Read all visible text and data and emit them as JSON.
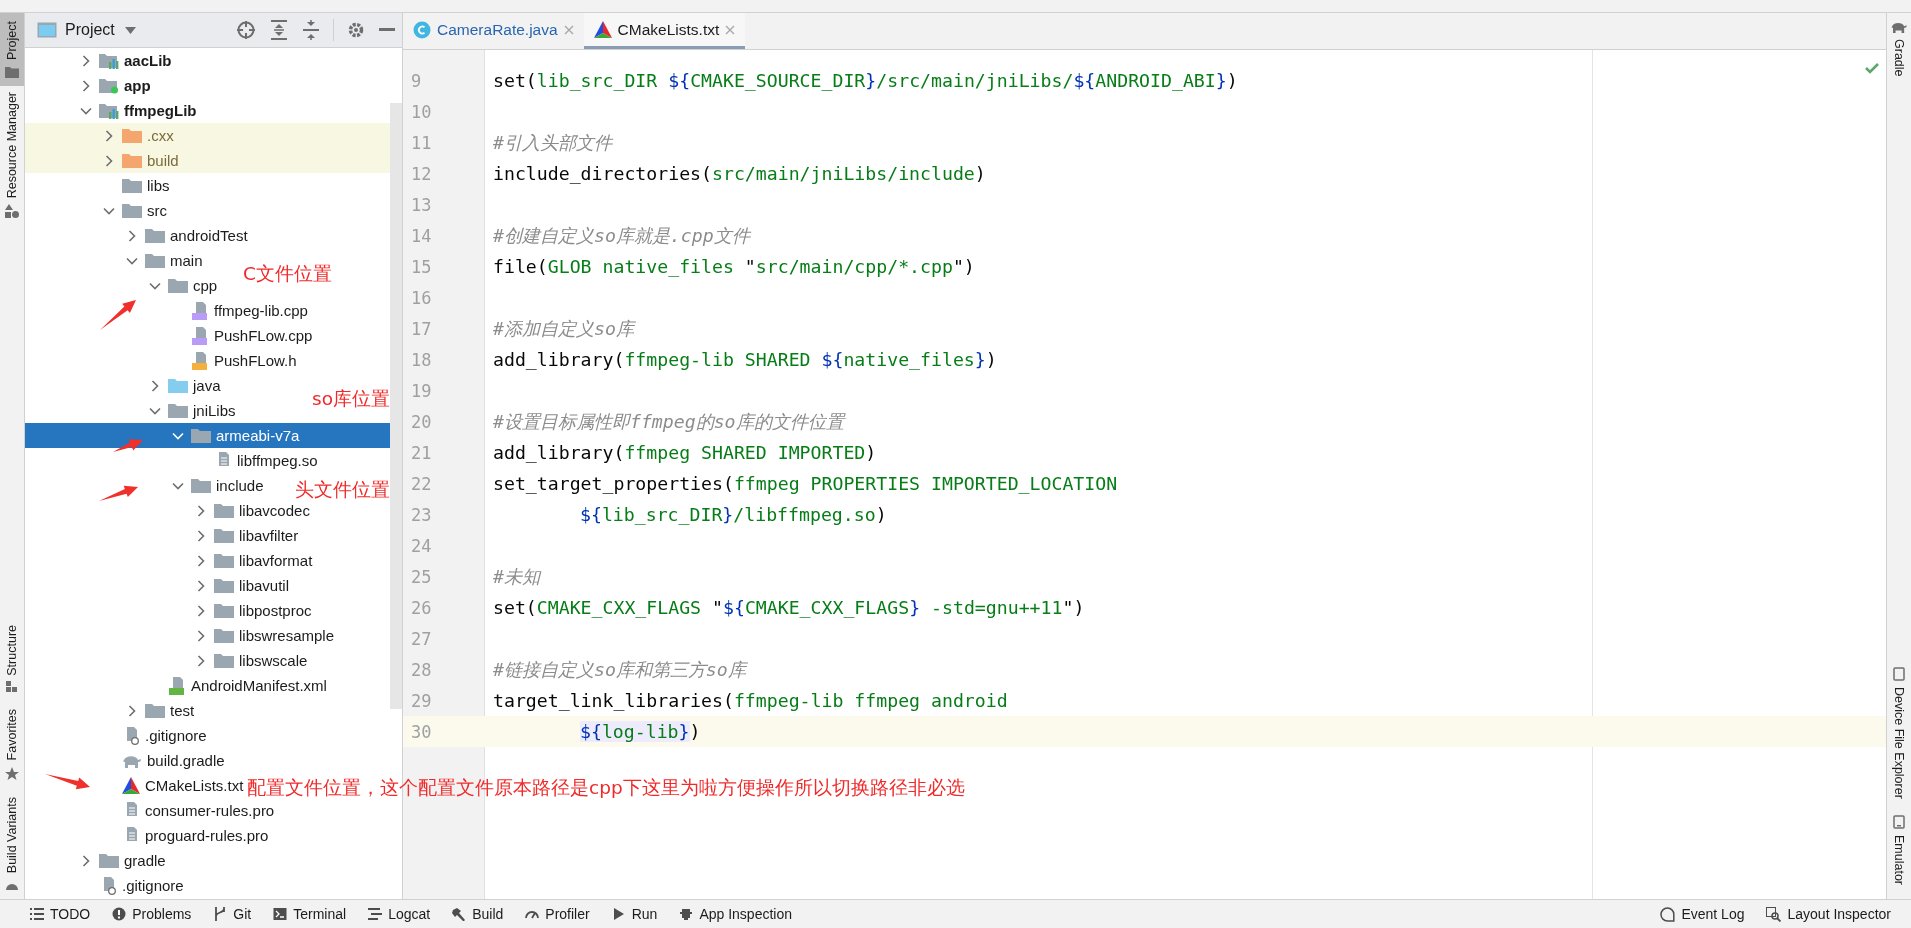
{
  "left_tool_window_bar": [
    {
      "label": "Project",
      "kind": "project",
      "selected": true
    },
    {
      "label": "Resource Manager",
      "kind": "resources",
      "selected": false
    },
    {
      "label": "Structure",
      "kind": "structure",
      "selected": false
    },
    {
      "label": "Favorites",
      "kind": "favorites",
      "selected": false
    },
    {
      "label": "Build Variants",
      "kind": "variants",
      "selected": false
    }
  ],
  "project_panel": {
    "title": "Project",
    "tree": [
      {
        "label": "aacLib",
        "kind": "module",
        "expanded": false,
        "selected": false
      },
      {
        "label": "app",
        "kind": "module-app",
        "expanded": false,
        "selected": false
      },
      {
        "label": "ffmpegLib",
        "kind": "module",
        "expanded": true,
        "selected": false,
        "children": [
          {
            "label": ".cxx",
            "kind": "folder-excluded",
            "expanded": false,
            "selected": false
          },
          {
            "label": "build",
            "kind": "folder-excluded",
            "expanded": false,
            "selected": false
          },
          {
            "label": "libs",
            "kind": "folder",
            "selected": false
          },
          {
            "label": "src",
            "kind": "folder",
            "expanded": true,
            "selected": false,
            "children": [
              {
                "label": "androidTest",
                "kind": "folder",
                "expanded": false,
                "selected": false
              },
              {
                "label": "main",
                "kind": "folder",
                "expanded": true,
                "selected": false,
                "children": [
                  {
                    "label": "cpp",
                    "kind": "folder",
                    "expanded": true,
                    "selected": false,
                    "children": [
                      {
                        "label": "ffmpeg-lib.cpp",
                        "kind": "file-cpp",
                        "selected": false
                      },
                      {
                        "label": "PushFLow.cpp",
                        "kind": "file-cpp",
                        "selected": false
                      },
                      {
                        "label": "PushFLow.h",
                        "kind": "file-h",
                        "selected": false
                      }
                    ]
                  },
                  {
                    "label": "java",
                    "kind": "folder-source",
                    "expanded": false,
                    "selected": false
                  },
                  {
                    "label": "jniLibs",
                    "kind": "folder",
                    "expanded": true,
                    "selected": false,
                    "children": [
                      {
                        "label": "armeabi-v7a",
                        "kind": "folder",
                        "expanded": true,
                        "selected": true,
                        "children": [
                          {
                            "label": "libffmpeg.so",
                            "kind": "file-text",
                            "selected": false
                          }
                        ]
                      },
                      {
                        "label": "include",
                        "kind": "folder",
                        "expanded": true,
                        "selected": false,
                        "children": [
                          {
                            "label": "libavcodec",
                            "kind": "folder",
                            "expanded": false,
                            "selected": false
                          },
                          {
                            "label": "libavfilter",
                            "kind": "folder",
                            "expanded": false,
                            "selected": false
                          },
                          {
                            "label": "libavformat",
                            "kind": "folder",
                            "expanded": false,
                            "selected": false
                          },
                          {
                            "label": "libavutil",
                            "kind": "folder",
                            "expanded": false,
                            "selected": false
                          },
                          {
                            "label": "libpostproc",
                            "kind": "folder",
                            "expanded": false,
                            "selected": false
                          },
                          {
                            "label": "libswresample",
                            "kind": "folder",
                            "expanded": false,
                            "selected": false
                          },
                          {
                            "label": "libswscale",
                            "kind": "folder",
                            "expanded": false,
                            "selected": false
                          }
                        ]
                      }
                    ]
                  },
                  {
                    "label": "AndroidManifest.xml",
                    "kind": "file-manifest",
                    "selected": false
                  }
                ]
              },
              {
                "label": "test",
                "kind": "folder",
                "expanded": false,
                "selected": false
              }
            ]
          },
          {
            "label": ".gitignore",
            "kind": "file-ignore",
            "selected": false
          },
          {
            "label": "build.gradle",
            "kind": "file-gradle",
            "selected": false
          },
          {
            "label": "CMakeLists.txt",
            "kind": "file-cmake",
            "selected": false
          },
          {
            "label": "consumer-rules.pro",
            "kind": "file-text",
            "selected": false
          },
          {
            "label": "proguard-rules.pro",
            "kind": "file-text",
            "selected": false
          }
        ]
      },
      {
        "label": "gradle",
        "kind": "folder",
        "expanded": false,
        "selected": false
      },
      {
        "label": ".gitignore",
        "kind": "file-ignore",
        "selected": false
      }
    ]
  },
  "editor": {
    "tabs": [
      {
        "label": "CameraRate.java",
        "kind": "java",
        "selected": false
      },
      {
        "label": "CMakeLists.txt",
        "kind": "cmake",
        "selected": true
      }
    ],
    "lines": [
      {
        "number": "9",
        "current": false,
        "tokens": [
          {
            "kind": "plain",
            "text": "set("
          },
          {
            "kind": "arg",
            "text": "lib_src_DIR "
          },
          {
            "kind": "brace",
            "text": "${"
          },
          {
            "kind": "arg",
            "text": "CMAKE_SOURCE_DIR"
          },
          {
            "kind": "brace",
            "text": "}"
          },
          {
            "kind": "arg",
            "text": "/src/main/jniLibs/"
          },
          {
            "kind": "brace",
            "text": "${"
          },
          {
            "kind": "arg",
            "text": "ANDROID_ABI"
          },
          {
            "kind": "brace",
            "text": "}"
          },
          {
            "kind": "plain",
            "text": ")"
          }
        ]
      },
      {
        "number": "10",
        "current": false
      },
      {
        "number": "11",
        "current": false,
        "tokens": [
          {
            "kind": "comment",
            "text": "#引入头部文件"
          }
        ]
      },
      {
        "number": "12",
        "current": false,
        "tokens": [
          {
            "kind": "plain",
            "text": "include_directories("
          },
          {
            "kind": "arg",
            "text": "src/main/jniLibs/include"
          },
          {
            "kind": "plain",
            "text": ")"
          }
        ]
      },
      {
        "number": "13",
        "current": false
      },
      {
        "number": "14",
        "current": false,
        "tokens": [
          {
            "kind": "comment",
            "text": "#创建自定义so库就是.cpp文件"
          }
        ]
      },
      {
        "number": "15",
        "current": false,
        "tokens": [
          {
            "kind": "plain",
            "text": "file("
          },
          {
            "kind": "arg",
            "text": "GLOB native_files "
          },
          {
            "kind": "plain",
            "text": "\""
          },
          {
            "kind": "arg",
            "text": "src/main/cpp/*.cpp"
          },
          {
            "kind": "plain",
            "text": "\")"
          }
        ]
      },
      {
        "number": "16",
        "current": false
      },
      {
        "number": "17",
        "current": false,
        "tokens": [
          {
            "kind": "comment",
            "text": "#添加自定义so库"
          }
        ]
      },
      {
        "number": "18",
        "current": false,
        "tokens": [
          {
            "kind": "plain",
            "text": "add_library("
          },
          {
            "kind": "arg",
            "text": "ffmpeg-lib SHARED "
          },
          {
            "kind": "brace",
            "text": "${"
          },
          {
            "kind": "arg",
            "text": "native_files"
          },
          {
            "kind": "brace",
            "text": "}"
          },
          {
            "kind": "plain",
            "text": ")"
          }
        ]
      },
      {
        "number": "19",
        "current": false
      },
      {
        "number": "20",
        "current": false,
        "tokens": [
          {
            "kind": "comment",
            "text": "#设置目标属性即ffmpeg的so库的文件位置"
          }
        ]
      },
      {
        "number": "21",
        "current": false,
        "tokens": [
          {
            "kind": "plain",
            "text": "add_library("
          },
          {
            "kind": "arg",
            "text": "ffmpeg SHARED IMPORTED"
          },
          {
            "kind": "plain",
            "text": ")"
          }
        ]
      },
      {
        "number": "22",
        "current": false,
        "tokens": [
          {
            "kind": "plain",
            "text": "set_target_properties("
          },
          {
            "kind": "arg",
            "text": "ffmpeg PROPERTIES IMPORTED_LOCATION"
          }
        ]
      },
      {
        "number": "23",
        "current": false,
        "indent": true,
        "tokens": [
          {
            "kind": "brace",
            "text": "${"
          },
          {
            "kind": "arg",
            "text": "lib_src_DIR"
          },
          {
            "kind": "brace",
            "text": "}"
          },
          {
            "kind": "arg",
            "text": "/libffmpeg.so"
          },
          {
            "kind": "plain",
            "text": ")"
          }
        ]
      },
      {
        "number": "24",
        "current": false
      },
      {
        "number": "25",
        "current": false,
        "tokens": [
          {
            "kind": "comment",
            "text": "#未知"
          }
        ]
      },
      {
        "number": "26",
        "current": false,
        "tokens": [
          {
            "kind": "plain",
            "text": "set("
          },
          {
            "kind": "arg",
            "text": "CMAKE_CXX_FLAGS "
          },
          {
            "kind": "plain",
            "text": "\""
          },
          {
            "kind": "brace",
            "text": "${"
          },
          {
            "kind": "arg",
            "text": "CMAKE_CXX_FLAGS"
          },
          {
            "kind": "brace",
            "text": "}"
          },
          {
            "kind": "arg",
            "text": " -std=gnu++11"
          },
          {
            "kind": "plain",
            "text": "\")"
          }
        ]
      },
      {
        "number": "27",
        "current": false
      },
      {
        "number": "28",
        "current": false,
        "tokens": [
          {
            "kind": "comment",
            "text": "#链接自定义so库和第三方so库"
          }
        ]
      },
      {
        "number": "29",
        "current": false,
        "tokens": [
          {
            "kind": "plain",
            "text": "target_link_libraries("
          },
          {
            "kind": "arg",
            "text": "ffmpeg-lib ffmpeg android"
          }
        ]
      },
      {
        "number": "30",
        "current": true,
        "indent": true,
        "tokens": [
          {
            "kind": "brace",
            "text": "${",
            "marked": true
          },
          {
            "kind": "arg",
            "text": "log-lib",
            "marked": true
          },
          {
            "kind": "brace",
            "text": "}",
            "marked": true
          },
          {
            "kind": "plain",
            "text": ")"
          }
        ]
      }
    ]
  },
  "right_tool_window_bar": [
    {
      "label": "Gradle",
      "kind": "gradle"
    },
    {
      "label": "Device File Explorer",
      "kind": "device"
    },
    {
      "label": "Emulator",
      "kind": "emulator"
    }
  ],
  "status_bar": {
    "left": [
      {
        "label": "TODO",
        "kind": "todo"
      },
      {
        "label": "Problems",
        "kind": "problems"
      },
      {
        "label": "Git",
        "kind": "git"
      },
      {
        "label": "Terminal",
        "kind": "terminal"
      },
      {
        "label": "Logcat",
        "kind": "logcat"
      },
      {
        "label": "Build",
        "kind": "build"
      },
      {
        "label": "Profiler",
        "kind": "profiler"
      },
      {
        "label": "Run",
        "kind": "run"
      },
      {
        "label": "App Inspection",
        "kind": "inspection"
      }
    ],
    "right": [
      {
        "label": "Event Log",
        "kind": "event"
      },
      {
        "label": "Layout Inspector",
        "kind": "layout"
      }
    ]
  },
  "annotations": [
    {
      "text": "C文件位置"
    },
    {
      "text": "so库位置"
    },
    {
      "text": "头文件位置"
    },
    {
      "text": "配置文件位置，这个配置文件原本路径是cpp下这里为啦方便操作所以切换路径非必选"
    }
  ]
}
